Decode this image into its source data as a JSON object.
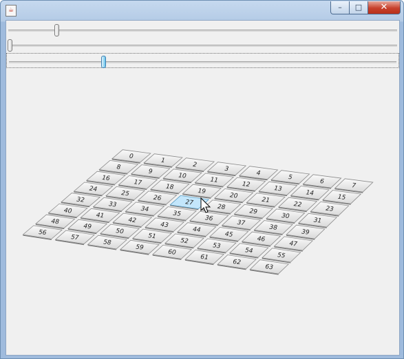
{
  "window": {
    "title": "",
    "buttons": {
      "minimize": "–",
      "maximize": "□",
      "close": "✕"
    }
  },
  "sliders": [
    {
      "name": "slider-1",
      "value": 0.13,
      "focused": false
    },
    {
      "name": "slider-2",
      "value": 0.0,
      "focused": false
    },
    {
      "name": "slider-3",
      "value": 0.25,
      "focused": true
    }
  ],
  "board": {
    "rows": 8,
    "cols": 8,
    "tiles": [
      "0",
      "1",
      "2",
      "3",
      "4",
      "5",
      "6",
      "7",
      "8",
      "9",
      "10",
      "11",
      "12",
      "13",
      "14",
      "15",
      "16",
      "17",
      "18",
      "19",
      "20",
      "21",
      "22",
      "23",
      "24",
      "25",
      "26",
      "27",
      "28",
      "29",
      "30",
      "31",
      "32",
      "33",
      "34",
      "35",
      "36",
      "37",
      "38",
      "39",
      "40",
      "41",
      "42",
      "43",
      "44",
      "45",
      "46",
      "47",
      "48",
      "49",
      "50",
      "51",
      "52",
      "53",
      "54",
      "55",
      "56",
      "57",
      "58",
      "59",
      "60",
      "61",
      "62",
      "63"
    ],
    "highlighted": "27",
    "highlight_color": "#c3e6fb"
  },
  "cursor": {
    "type": "arrow-pointer"
  }
}
